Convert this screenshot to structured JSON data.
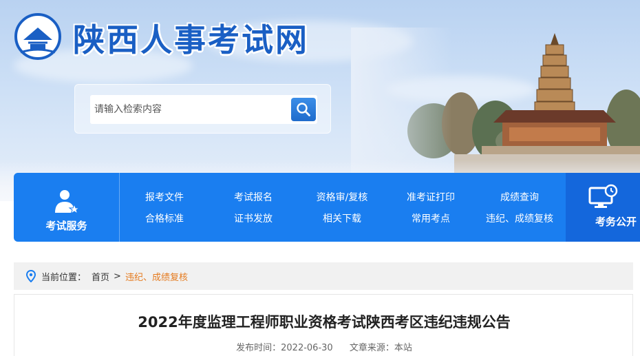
{
  "site": {
    "title": "陕西人事考试网"
  },
  "search": {
    "placeholder": "请输入检索内容"
  },
  "nav": {
    "service_label": "考试服务",
    "links": [
      {
        "label": "报考文件"
      },
      {
        "label": "考试报名"
      },
      {
        "label": "资格审/复核"
      },
      {
        "label": "准考证打印"
      },
      {
        "label": "成绩查询"
      },
      {
        "label": "合格标准"
      },
      {
        "label": "证书发放"
      },
      {
        "label": "相关下载"
      },
      {
        "label": "常用考点"
      },
      {
        "label": "违纪、成绩复核"
      }
    ],
    "right_label": "考务公开"
  },
  "breadcrumb": {
    "prefix": "当前位置：",
    "home": "首页",
    "separator": ">",
    "current": "违纪、成绩复核"
  },
  "article": {
    "title": "2022年度监理工程师职业资格考试陕西考区违纪违规公告",
    "publish_label": "发布时间：2022-06-30",
    "source_label": "文章来源：本站"
  },
  "colors": {
    "brand_blue": "#1a7ef0",
    "title_blue": "#1a5fc4",
    "accent_orange": "#e57b1f"
  }
}
